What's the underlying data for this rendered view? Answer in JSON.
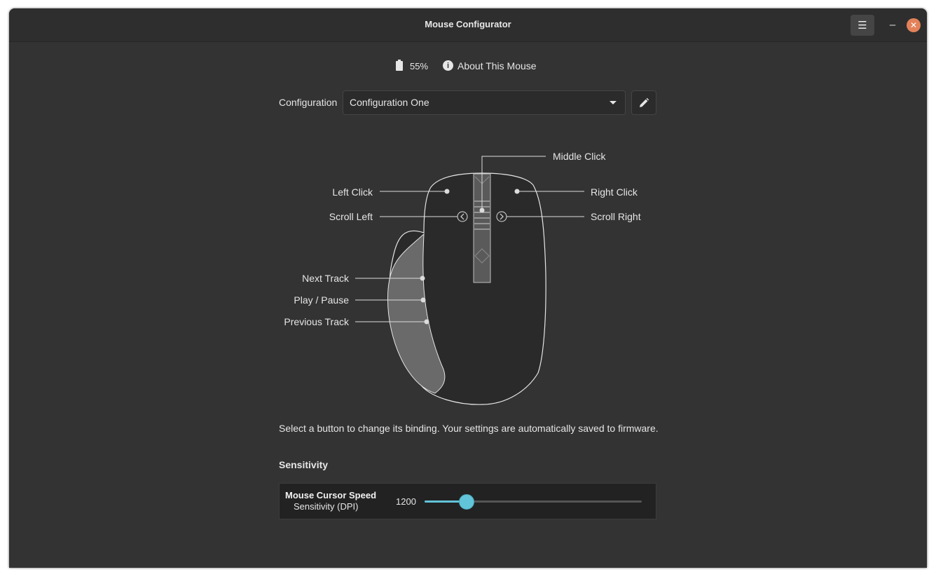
{
  "window": {
    "title": "Mouse Configurator",
    "menu_icon": "hamburger-icon",
    "minimize_icon": "minimize-icon",
    "close_icon": "close-icon",
    "close_color": "#e3825a"
  },
  "status": {
    "battery": "55%",
    "about_label": "About This Mouse"
  },
  "configuration": {
    "label": "Configuration",
    "selected": "Configuration One",
    "edit_icon": "pencil-icon"
  },
  "buttons": {
    "middle_click": "Middle Click",
    "left_click": "Left Click",
    "right_click": "Right Click",
    "scroll_left": "Scroll Left",
    "scroll_right": "Scroll Right",
    "next_track": "Next Track",
    "play_pause": "Play / Pause",
    "previous_track": "Previous Track"
  },
  "hint": "Select a button to change its binding. Your settings are automatically saved to firmware.",
  "sensitivity": {
    "heading": "Sensitivity",
    "name": "Mouse Cursor Speed",
    "subtitle": "Sensitivity (DPI)",
    "value": "1200",
    "slider_fraction": 0.19,
    "accent": "#62c4d8"
  }
}
